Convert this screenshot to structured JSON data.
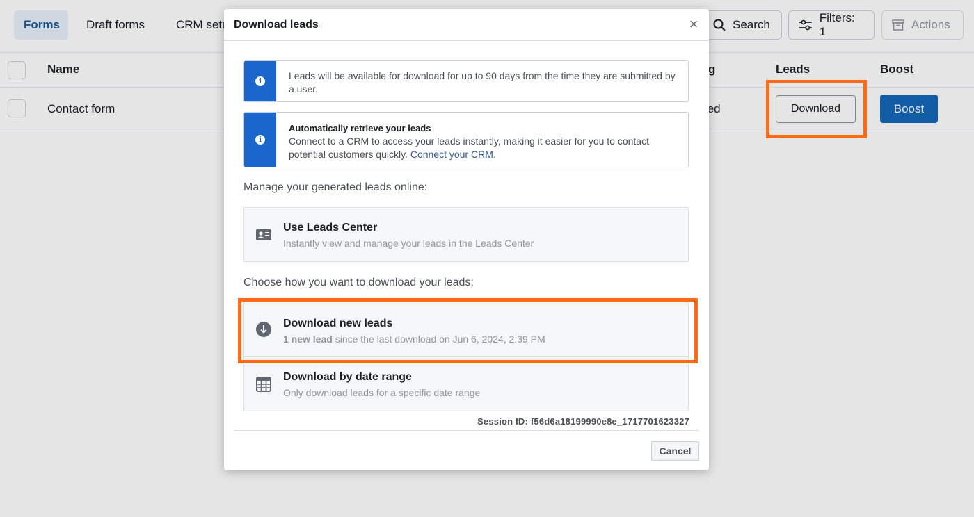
{
  "nav": {
    "tabs": [
      "Forms",
      "Draft forms",
      "CRM setup"
    ],
    "search_label": "Search",
    "filters_label": "Filters: 1",
    "actions_label": "Actions"
  },
  "table": {
    "headers": {
      "name": "Name",
      "status_partial": "g",
      "leads": "Leads",
      "boost": "Boost"
    },
    "row": {
      "name": "Contact form",
      "status_partial": "ted",
      "download_label": "Download",
      "boost_label": "Boost"
    }
  },
  "modal": {
    "title": "Download leads",
    "close_glyph": "×",
    "info1": "Leads will be available for download for up to 90 days from the time they are submitted by a user.",
    "info2_title": "Automatically retrieve your leads",
    "info2_body": "Connect to a CRM to access your leads instantly, making it easier for you to contact potential customers quickly.",
    "info2_link": "Connect your CRM.",
    "manage_label": "Manage your generated leads online:",
    "leads_center_title": "Use Leads Center",
    "leads_center_sub": "Instantly view and manage your leads in the Leads Center",
    "choose_label": "Choose how you want to download your leads:",
    "new_leads_title": "Download new leads",
    "new_leads_count": "1 new lead",
    "new_leads_sub": "since the last download on Jun 6, 2024, 2:39 PM",
    "date_range_title": "Download by date range",
    "date_range_sub": "Only download leads for a specific date range",
    "session_id": "Session ID: f56d6a18199990e8e_1717701623327",
    "cancel_label": "Cancel"
  },
  "colors": {
    "accent_blue": "#1a66cc",
    "boost_blue": "#1467b7",
    "highlight_orange": "#ff6a13"
  }
}
